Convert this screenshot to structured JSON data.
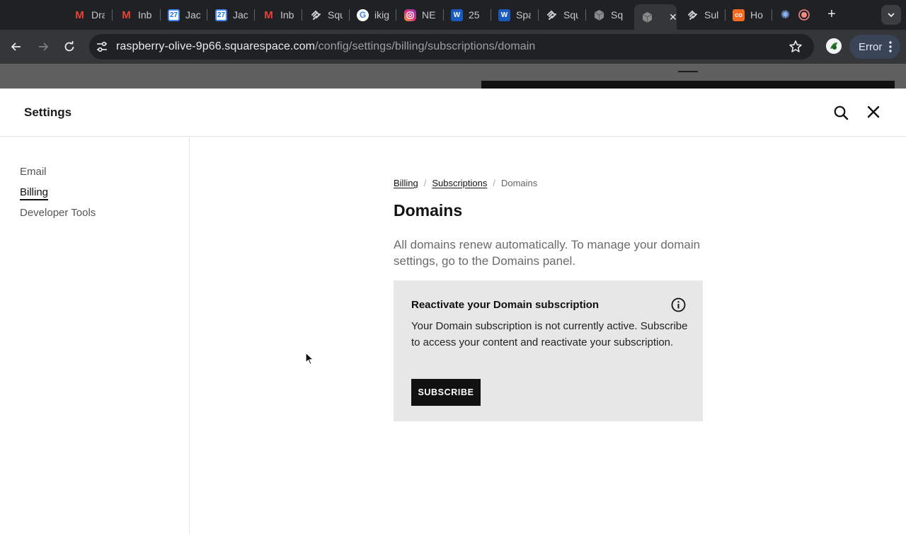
{
  "browser": {
    "tabs": [
      {
        "label": "Dra",
        "icon": "gmail-icon"
      },
      {
        "label": "Inb",
        "icon": "gmail-icon"
      },
      {
        "label": "Jac",
        "icon": "google-calendar-icon",
        "icon_text": "27"
      },
      {
        "label": "Jac",
        "icon": "google-calendar-icon",
        "icon_text": "27"
      },
      {
        "label": "Inb",
        "icon": "gmail-icon"
      },
      {
        "label": "Squ",
        "icon": "squarespace-icon"
      },
      {
        "label": "ikig",
        "icon": "google-icon"
      },
      {
        "label": "NE",
        "icon": "instagram-icon"
      },
      {
        "label": "25",
        "icon": "word-icon",
        "icon_text": "W"
      },
      {
        "label": "Spa",
        "icon": "word-icon",
        "icon_text": "W"
      },
      {
        "label": "Squ",
        "icon": "squarespace-icon"
      },
      {
        "label": "Sq",
        "icon": "cube-icon"
      },
      {
        "label": "",
        "icon": "cube-icon",
        "active": true
      },
      {
        "label": "Sul",
        "icon": "squarespace-icon"
      },
      {
        "label": "Ho",
        "icon": "orange-co-icon",
        "icon_text": "co"
      },
      {
        "label": "",
        "icon": "gear-puzzle-icon"
      },
      {
        "label": "",
        "icon": "record-icon"
      }
    ],
    "new_tab": "+",
    "url_host": "raspberry-olive-9p66.squarespace.com",
    "url_path": "/config/settings/billing/subscriptions/domain",
    "error_chip": "Error",
    "colors": {
      "tabstrip": "#202124",
      "toolbar": "#35363a",
      "error_chip_bg": "#394457"
    }
  },
  "settings": {
    "title": "Settings",
    "nav": [
      {
        "label": "Email",
        "active": false
      },
      {
        "label": "Billing",
        "active": true
      },
      {
        "label": "Developer Tools",
        "active": false
      }
    ],
    "breadcrumb": [
      {
        "label": "Billing",
        "link": true
      },
      {
        "label": "Subscriptions",
        "link": true
      },
      {
        "label": "Domains",
        "link": false
      }
    ],
    "breadcrumb_sep": "/",
    "page_title": "Domains",
    "description": "All domains renew automatically. To manage your domain settings, go to the Domains panel.",
    "notice": {
      "title": "Reactivate your Domain subscription",
      "body": "Your Domain subscription is not currently active. Subscribe to access your content and reactivate your subscription.",
      "button": "SUBSCRIBE",
      "bg_color": "#e7e7e7"
    }
  }
}
